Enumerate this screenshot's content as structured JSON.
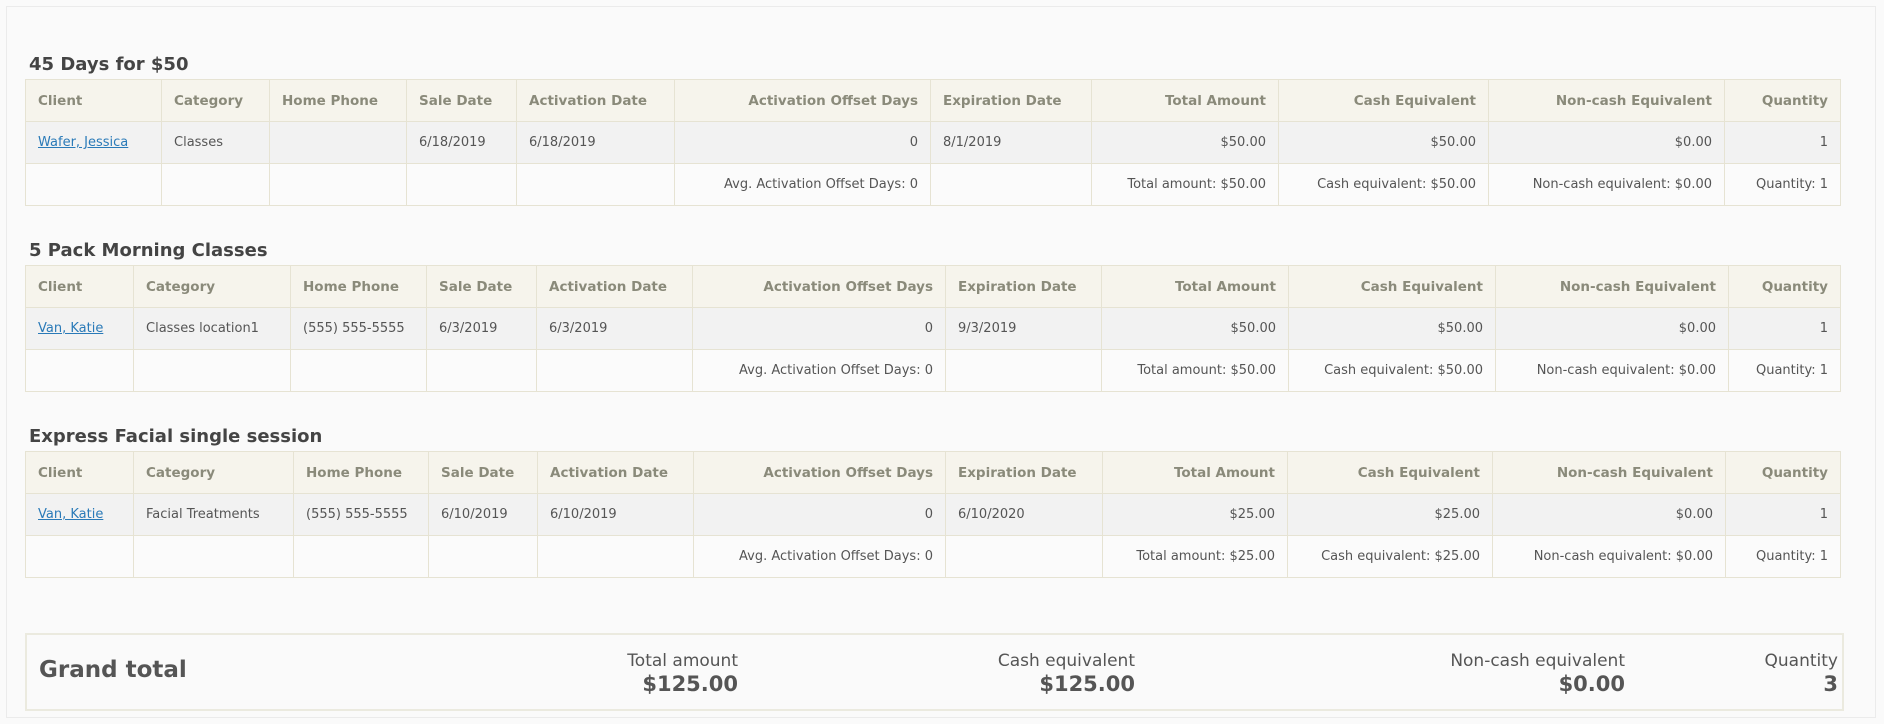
{
  "columns": {
    "client": "Client",
    "category": "Category",
    "home_phone": "Home Phone",
    "sale_date": "Sale Date",
    "activation_date": "Activation Date",
    "offset_days": "Activation Offset Days",
    "expiration_date": "Expiration Date",
    "total_amount": "Total Amount",
    "cash_equivalent": "Cash Equivalent",
    "noncash_equivalent": "Non-cash Equivalent",
    "quantity": "Quantity"
  },
  "sections": [
    {
      "title": "45 Days for $50",
      "row": {
        "client": "Wafer, Jessica",
        "category": "Classes",
        "home_phone": "",
        "sale_date": "6/18/2019",
        "activation_date": "6/18/2019",
        "offset_days": "0",
        "expiration_date": "8/1/2019",
        "total_amount": "$50.00",
        "cash_equivalent": "$50.00",
        "noncash_equivalent": "$0.00",
        "quantity": "1"
      },
      "summary": {
        "avg_offset": "Avg. Activation Offset Days: 0",
        "total_amount": "Total amount: $50.00",
        "cash_equivalent": "Cash equivalent: $50.00",
        "noncash_equivalent": "Non-cash equivalent: $0.00",
        "quantity": "Quantity: 1"
      }
    },
    {
      "title": "5 Pack Morning Classes",
      "row": {
        "client": "Van, Katie",
        "category": "Classes location1",
        "home_phone": "(555) 555-5555",
        "sale_date": "6/3/2019",
        "activation_date": "6/3/2019",
        "offset_days": "0",
        "expiration_date": "9/3/2019",
        "total_amount": "$50.00",
        "cash_equivalent": "$50.00",
        "noncash_equivalent": "$0.00",
        "quantity": "1"
      },
      "summary": {
        "avg_offset": "Avg. Activation Offset Days: 0",
        "total_amount": "Total amount: $50.00",
        "cash_equivalent": "Cash equivalent: $50.00",
        "noncash_equivalent": "Non-cash equivalent: $0.00",
        "quantity": "Quantity: 1"
      }
    },
    {
      "title": "Express Facial single session",
      "row": {
        "client": "Van, Katie",
        "category": "Facial Treatments",
        "home_phone": "(555) 555-5555",
        "sale_date": "6/10/2019",
        "activation_date": "6/10/2019",
        "offset_days": "0",
        "expiration_date": "6/10/2020",
        "total_amount": "$25.00",
        "cash_equivalent": "$25.00",
        "noncash_equivalent": "$0.00",
        "quantity": "1"
      },
      "summary": {
        "avg_offset": "Avg. Activation Offset Days: 0",
        "total_amount": "Total amount: $25.00",
        "cash_equivalent": "Cash equivalent: $25.00",
        "noncash_equivalent": "Non-cash equivalent: $0.00",
        "quantity": "Quantity: 1"
      }
    }
  ],
  "grand_total": {
    "label": "Grand total",
    "total_amount_label": "Total amount",
    "total_amount": "$125.00",
    "cash_equivalent_label": "Cash equivalent",
    "cash_equivalent": "$125.00",
    "noncash_equivalent_label": "Non-cash equivalent",
    "noncash_equivalent": "$0.00",
    "quantity_label": "Quantity",
    "quantity": "3"
  }
}
